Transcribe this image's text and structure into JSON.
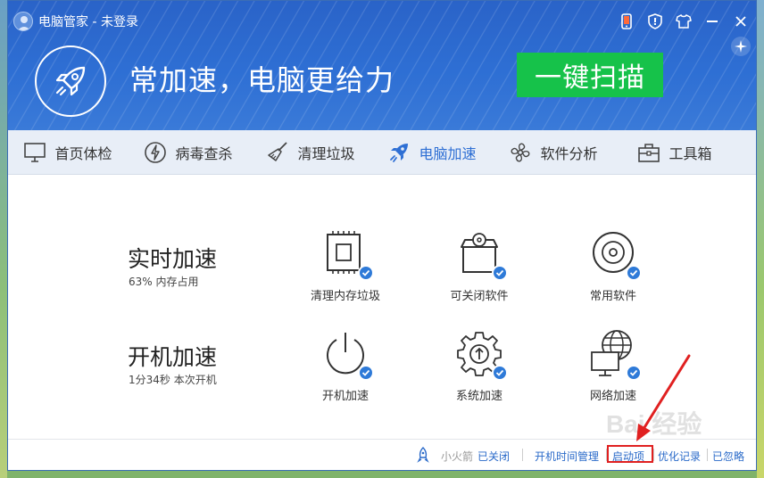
{
  "app": {
    "title": "电脑管家 - 未登录"
  },
  "header": {
    "slogan": "常加速，电脑更给力",
    "scan_button": "一键扫描",
    "title_icons": [
      "phone-icon",
      "shield-icon",
      "shirt-icon",
      "minimize-icon",
      "close-icon"
    ],
    "sparkle_icon": "sparkle-icon"
  },
  "tabs": [
    {
      "label": "首页体检",
      "icon": "monitor-icon",
      "active": false
    },
    {
      "label": "病毒查杀",
      "icon": "lightning-icon",
      "active": false
    },
    {
      "label": "清理垃圾",
      "icon": "broom-icon",
      "active": false
    },
    {
      "label": "电脑加速",
      "icon": "rocket-icon",
      "active": true
    },
    {
      "label": "软件分析",
      "icon": "fan-icon",
      "active": false
    },
    {
      "label": "工具箱",
      "icon": "toolbox-icon",
      "active": false
    }
  ],
  "realtime": {
    "title": "实时加速",
    "subtitle": "63% 内存占用",
    "tools": [
      {
        "label": "清理内存垃圾",
        "icon": "memory-chip-icon"
      },
      {
        "label": "可关闭软件",
        "icon": "software-box-icon"
      },
      {
        "label": "常用软件",
        "icon": "disc-icon"
      }
    ]
  },
  "boot": {
    "title": "开机加速",
    "subtitle": "1分34秒 本次开机",
    "tools": [
      {
        "label": "开机加速",
        "icon": "power-icon"
      },
      {
        "label": "系统加速",
        "icon": "gear-icon"
      },
      {
        "label": "网络加速",
        "icon": "network-icon"
      }
    ]
  },
  "footer": {
    "rocket_label": "小火箭",
    "rocket_status": "已关闭",
    "boot_time": "开机时间管理",
    "startup_items": "启动项",
    "optimize_log": "优化记录",
    "ignored": "已忽略"
  },
  "colors": {
    "header_blue": "#2e6fd4",
    "scan_green": "#16c24a",
    "active_tab": "#2e6fd4",
    "highlight_red": "#e02020",
    "link_blue": "#2a6ac9"
  },
  "watermark": {
    "text": "Bai 经验"
  }
}
